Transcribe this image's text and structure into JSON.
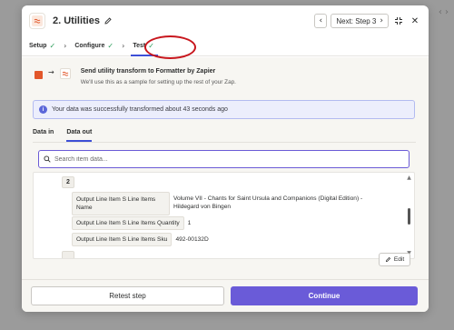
{
  "modal": {
    "title": "2. Utilities",
    "next_label": "Next: Step 3"
  },
  "steps": [
    {
      "label": "Setup"
    },
    {
      "label": "Configure"
    },
    {
      "label": "Test"
    }
  ],
  "transform": {
    "title": "Send utility transform to Formatter by Zapier",
    "subtitle": "We'll use this as a sample for setting up the rest of your Zap."
  },
  "info": {
    "message": "Your data was successfully transformed about 43 seconds ago"
  },
  "tabs": [
    {
      "label": "Data in"
    },
    {
      "label": "Data out"
    }
  ],
  "search": {
    "placeholder": "Search item data..."
  },
  "item": {
    "index": "2",
    "fields": [
      {
        "key_line1": "Output Line Item S Line Items",
        "key_line2": "Name",
        "value_line1": "Volume VII - Chants for Saint Ursula and Companions (Digital Edition) -",
        "value_line2": "Hildegard von Bingen"
      },
      {
        "key": "Output Line Item S Line Items Quantity",
        "value": "1"
      },
      {
        "key": "Output Line Item S Line Items Sku",
        "value": "492-00132D"
      }
    ]
  },
  "actions": {
    "edit_label": "Edit",
    "retest_label": "Retest step",
    "continue_label": "Continue"
  },
  "colors": {
    "accent": "#6a5bd8",
    "success": "#2a9d5a",
    "annotation": "#c8161d"
  }
}
